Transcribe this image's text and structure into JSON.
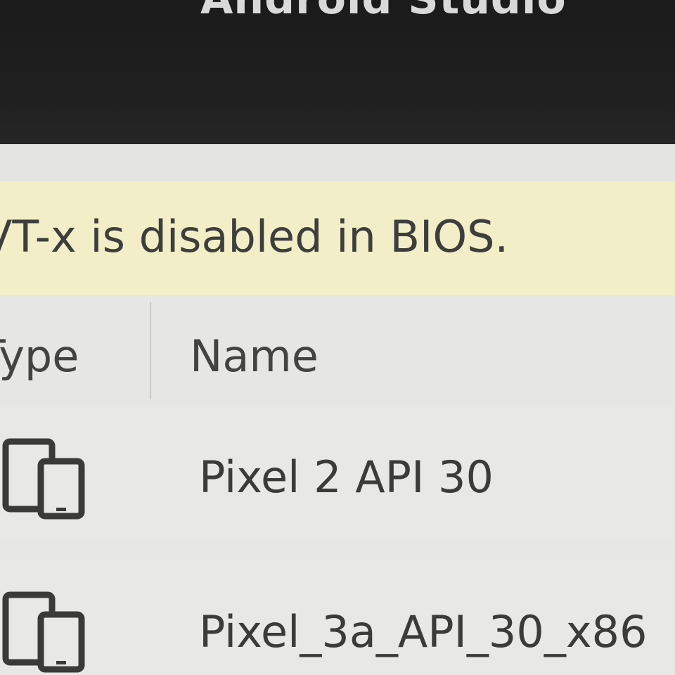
{
  "window": {
    "title": "Android Studio"
  },
  "banner": {
    "message": "VT-x is disabled in BIOS."
  },
  "table": {
    "headers": {
      "type": "Type",
      "name": "Name"
    },
    "rows": [
      {
        "type_icon": "device-phone-tablet-icon",
        "name": "Pixel 2 API 30"
      },
      {
        "type_icon": "device-phone-tablet-icon",
        "name": "Pixel_3a_API_30_x86"
      }
    ]
  },
  "colors": {
    "titlebar": "#1f1f1f",
    "banner": "#f2efc8",
    "background": "#e7e7e6",
    "text": "#3e3e3c",
    "logo_green": "#3ddc84"
  }
}
